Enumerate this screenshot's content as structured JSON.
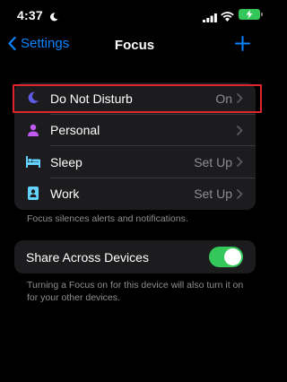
{
  "status_bar": {
    "time": "4:37"
  },
  "nav": {
    "back_label": "Settings",
    "title": "Focus"
  },
  "focus_modes": [
    {
      "label": "Do Not Disturb",
      "value": "On",
      "icon": "moon-icon",
      "color": "#5e5ce6"
    },
    {
      "label": "Personal",
      "value": "",
      "icon": "person-icon",
      "color": "#bf5af2"
    },
    {
      "label": "Sleep",
      "value": "Set Up",
      "icon": "bed-icon",
      "color": "#64d2ff"
    },
    {
      "label": "Work",
      "value": "Set Up",
      "icon": "badge-icon",
      "color": "#64d2ff"
    }
  ],
  "focus_footnote": "Focus silences alerts and notifications.",
  "share": {
    "label": "Share Across Devices",
    "enabled": true,
    "footnote": "Turning a Focus on for this device will also turn it on for your other devices."
  },
  "colors": {
    "accent": "#0a84ff",
    "toggle_on": "#34c759",
    "highlight": "#e0242b"
  }
}
